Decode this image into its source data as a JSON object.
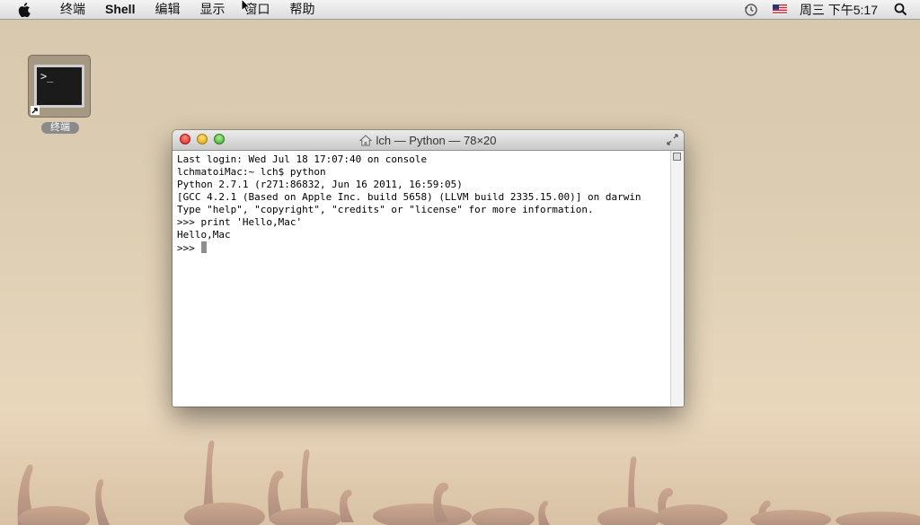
{
  "menubar": {
    "app_name": "终端",
    "items": [
      "Shell",
      "编辑",
      "显示",
      "窗口",
      "帮助"
    ],
    "clock": "周三 下午5:17"
  },
  "desktop_icon": {
    "label": "终端",
    "prompt_glyph": ">_"
  },
  "window": {
    "title": "lch — Python — 78×20",
    "lines": [
      "Last login: Wed Jul 18 17:07:40 on console",
      "lchmatoiMac:~ lch$ python",
      "Python 2.7.1 (r271:86832, Jun 16 2011, 16:59:05)",
      "[GCC 4.2.1 (Based on Apple Inc. build 5658) (LLVM build 2335.15.00)] on darwin",
      "Type \"help\", \"copyright\", \"credits\" or \"license\" for more information.",
      ">>> print 'Hello,Mac'",
      "Hello,Mac"
    ],
    "prompt": ">>> "
  },
  "icons": {
    "apple": "apple-icon",
    "time_machine": "time-machine-icon",
    "input_source": "us-flag-icon",
    "spotlight": "search-icon"
  },
  "colors": {
    "close": "#d7221d",
    "minimize": "#d9a007",
    "zoom": "#3fa52c"
  }
}
